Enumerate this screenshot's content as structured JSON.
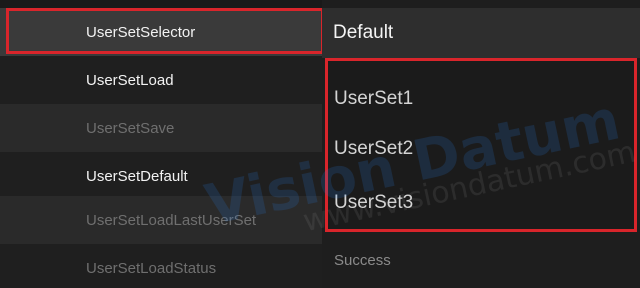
{
  "properties": [
    {
      "label": "UserSetSelector",
      "enabled": true
    },
    {
      "label": "UserSetLoad",
      "enabled": true
    },
    {
      "label": "UserSetSave",
      "enabled": false
    },
    {
      "label": "UserSetDefault",
      "enabled": true
    },
    {
      "label": "UserSetLoadLastUserSet",
      "enabled": false
    },
    {
      "label": "UserSetLoadStatus",
      "enabled": false
    }
  ],
  "selector": {
    "current_value": "Default",
    "options": [
      "UserSet1",
      "UserSet2",
      "UserSet3"
    ]
  },
  "status": {
    "value": "Success"
  },
  "watermark": {
    "brand": "Vision Datum",
    "url": "www.visiondatum.com"
  },
  "colors": {
    "highlight_border": "#d9252b",
    "watermark_blue": "#2878dc"
  }
}
